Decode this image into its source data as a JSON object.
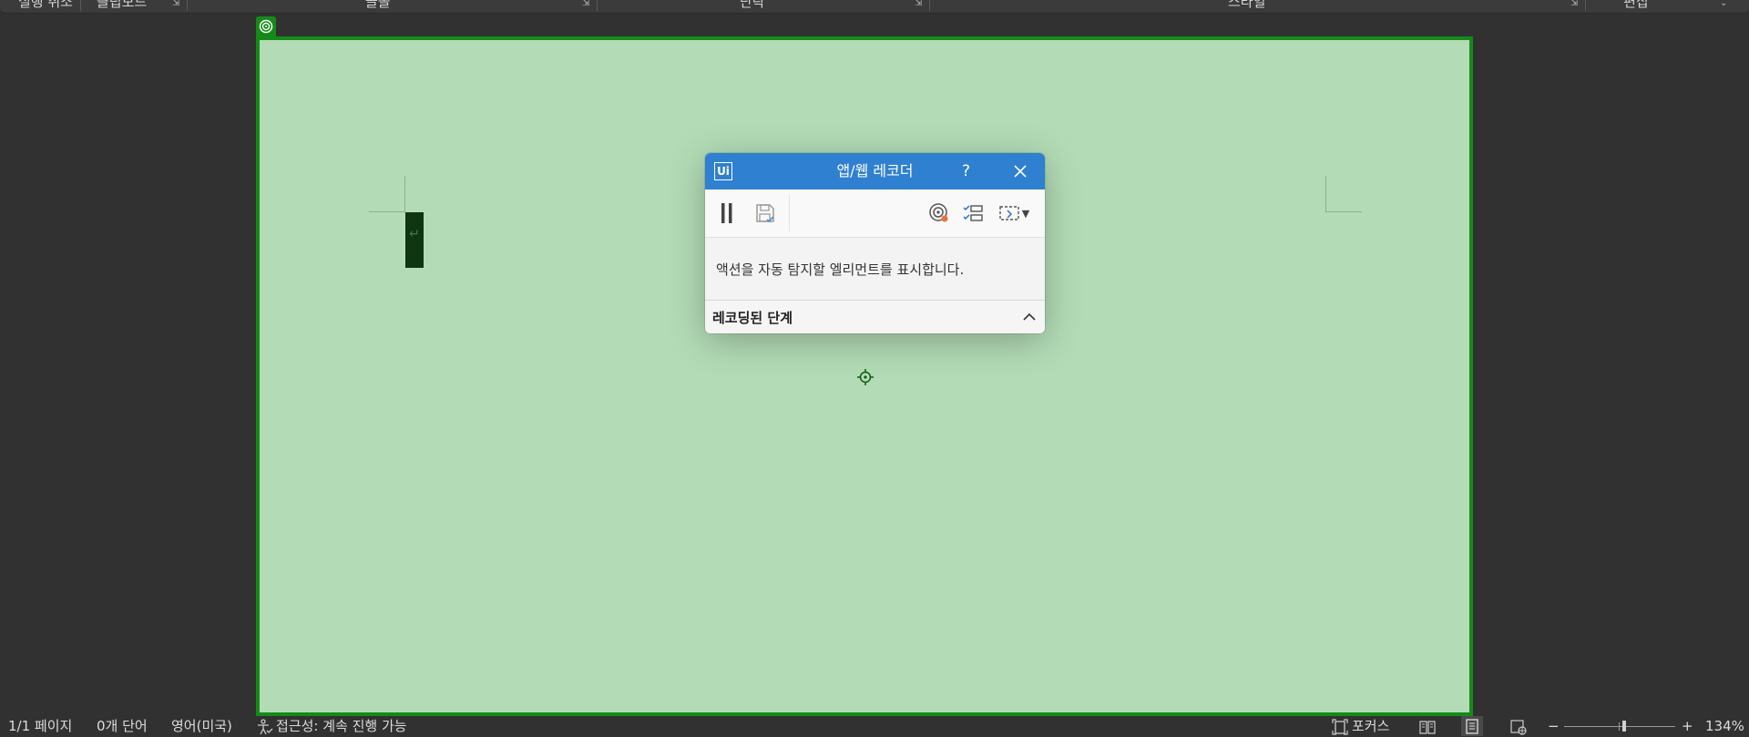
{
  "ribbon": {
    "groups": [
      {
        "label": "실행 취소"
      },
      {
        "label": "클립보드"
      },
      {
        "label": "글꼴"
      },
      {
        "label": "단락"
      },
      {
        "label": "스타일"
      },
      {
        "label": "편집"
      }
    ]
  },
  "document": {
    "background": "#b3dcb6",
    "highlight_color": "#158a19",
    "paragraph_mark": "↵"
  },
  "recorder": {
    "title": "앱/웹 레코더",
    "help_label": "?",
    "logo_text": "Ui",
    "message": "액션을 자동 탐지할 엘리먼트를 표시합니다.",
    "steps_header": "레코딩된 단계",
    "toolbar_icons": [
      "pause-icon",
      "save-icon",
      "target-icon",
      "checklist-icon",
      "screen-select-icon"
    ]
  },
  "statusbar": {
    "page": "1/1 페이지",
    "words": "0개 단어",
    "language": "영어(미국)",
    "accessibility": "접근성: 계속 진행 가능",
    "focus": "포커스",
    "zoom_minus": "−",
    "zoom_plus": "+",
    "zoom": "134%",
    "zoom_level_percent": 134
  }
}
